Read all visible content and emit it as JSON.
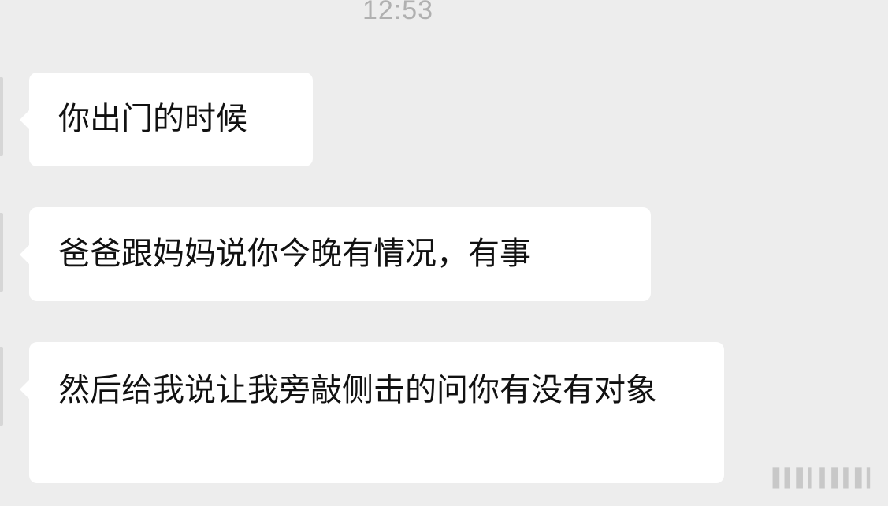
{
  "chat": {
    "timestamp": "12:53",
    "messages": [
      {
        "sender": "other",
        "text": "你出门的时候"
      },
      {
        "sender": "other",
        "text": "爸爸跟妈妈说你今晚有情况，有事"
      },
      {
        "sender": "other",
        "text": "然后给我说让我旁敲侧击的问你有没有对象"
      }
    ]
  },
  "colors": {
    "background": "#ededed",
    "bubble": "#ffffff",
    "text": "#111111",
    "timestamp": "#b0b0b0"
  },
  "watermark": {
    "icon": "blurred-watermark"
  }
}
